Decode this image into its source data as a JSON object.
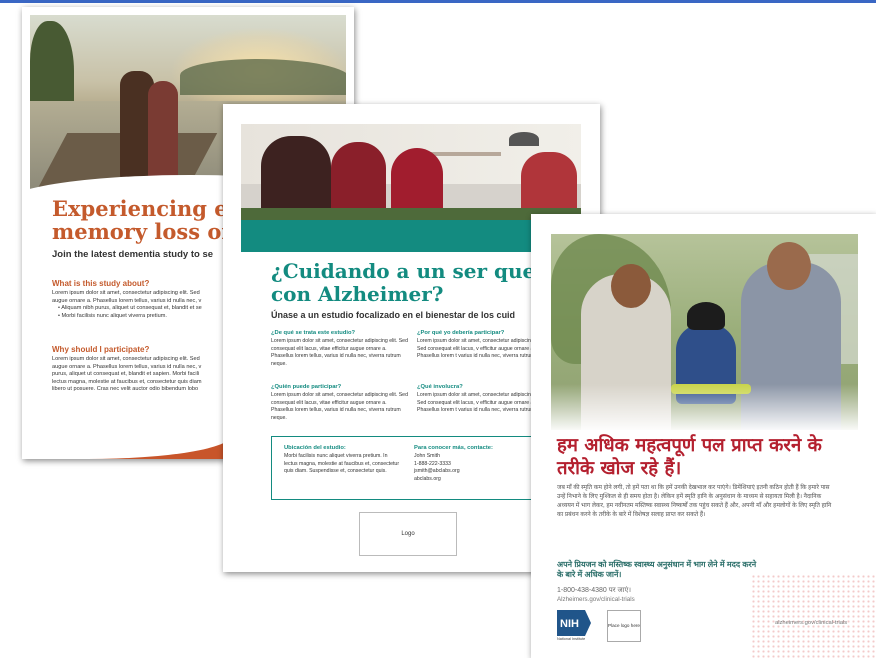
{
  "card1": {
    "title_line1": "Experiencing early",
    "title_line2": "memory loss or de",
    "subtitle": "Join the latest dementia study to se",
    "section1_heading": "What is this study about?",
    "section1_line1": "Lorem ipsum dolor sit amet, consectetur adipiscing elit. Sed",
    "section1_line2": "augue ornare a. Phasellus lorem tellus, varius id nulla nec, v",
    "bullet1": "Aliquam nibh purus, aliquet ut consequat et, blandit et se",
    "bullet2": "Morbi facilisis nunc aliquet viverra pretium.",
    "section2_heading": "Why should I participate?",
    "section2_line1": "Lorem ipsum dolor sit amet, consectetur adipiscing elit. Sed",
    "section2_line2": "augue ornare a. Phasellus lorem tellus, varius id nulla nec, v",
    "section2_line3": "purus, aliquet ut consequat et, blandit et sapien. Morbi facili",
    "section2_line4": "lectus magna, molestie at faucibus et, consectetur quis diam",
    "section2_line5": "libero ut posuere. Cras nec velit auctor odio bibendum lobo"
  },
  "card2": {
    "title_line1": "¿Cuidando a un ser queri",
    "title_line2": "con Alzheimer?",
    "subtitle": "Únase a un estudio focalizado en el bienestar de los cuid",
    "q1_heading": "¿De qué se trata este estudio?",
    "q1_text": "Lorem ipsum dolor sit amet, consectetur adipiscing elit. Sed consequat elit lacus, vitae efficitur augue ornare a. Phasellus lorem tellus, varius id nulla nec, viverra rutrum neque.",
    "q2_heading": "¿Por qué yo debería participar?",
    "q2_text": "Lorem ipsum dolor sit amet, consectetur adipiscing elit. Sed consequat elit lacus, v efficitur augue ornare a. Phasellus lorem t varius id nulla nec, viverra rutrum neque.",
    "q3_heading": "¿Quién puede participar?",
    "q3_text": "Lorem ipsum dolor sit amet, consectetur adipiscing elit. Sed consequat elit lacus, vitae efficitur augue ornare a. Phasellus lorem tellus, varius id nulla nec, viverra rutrum neque.",
    "q4_heading": "¿Qué involucra?",
    "q4_text": "Lorem ipsum dolor sit amet, consectetur adipiscing elit. Sed consequat elit lacus, v efficitur augue ornare a. Phasellus lorem t varius id nulla nec, viverra rutrum neque.",
    "location_heading": "Ubicación del estudio:",
    "location_text": "Morbi facilisis nunc aliquet viverra pretium. In lectus magna, molestie at faucibus et, consectetur quis diam. Suspendisse et, consectetur quis.",
    "contact_heading": "Para conocer más, contacte:",
    "contact_name": "John Smith",
    "contact_phone": "1-888-222-3333",
    "contact_email": "jsmith@abclabs.org",
    "contact_web": "abclabs.org",
    "logo_label": "Logo"
  },
  "card3": {
    "title": "हम अधिक महत्वपूर्ण पल प्राप्त करने के तरीके खोज रहे हैं।",
    "body": "जब माँ की स्मृति कम होने लगी, तो हमें पता था कि हमें उनकी देखभाल कर पाएंगे। डिमेंशियाएं इतनी कठिन होती हैं कि हमारे पास उन्हें निभाने के लिए मुश्किल से ही समय होता है। लेकिन हमें स्मृति हानि के अनुसंधान के माध्यम से सहायता मिली है। नैदानिक अध्ययन में भाग लेकर, हम नवीनतम मस्तिष्क स्वास्थ्य निष्कर्षों तक पहुंच सकते हैं और, अपनी माँ और हमलोगों के लिए स्मृति हानि का प्रबंधन करने के तरीके के बारे में विशेषज्ञ सलाह प्राप्त कर सकते हैं।",
    "cta": "अपने प्रियजन को मस्तिष्क स्वास्थ्य अनुसंधान में भाग लेने में मदद करने के बारे में अधिक जानें।",
    "phone": "1-800-438-4380 पर जाएं।",
    "url": "Alzheimers.gov/clinical-trials",
    "nih_label": "NIH",
    "nih_sub": "National Institute",
    "place_logo": "Place logo here",
    "footer_url": "alzheimers.gov/clinical-trials"
  },
  "colors": {
    "orange": "#c45a2c",
    "teal": "#138b80",
    "red": "#b4202f",
    "nih_blue": "#20558a"
  }
}
